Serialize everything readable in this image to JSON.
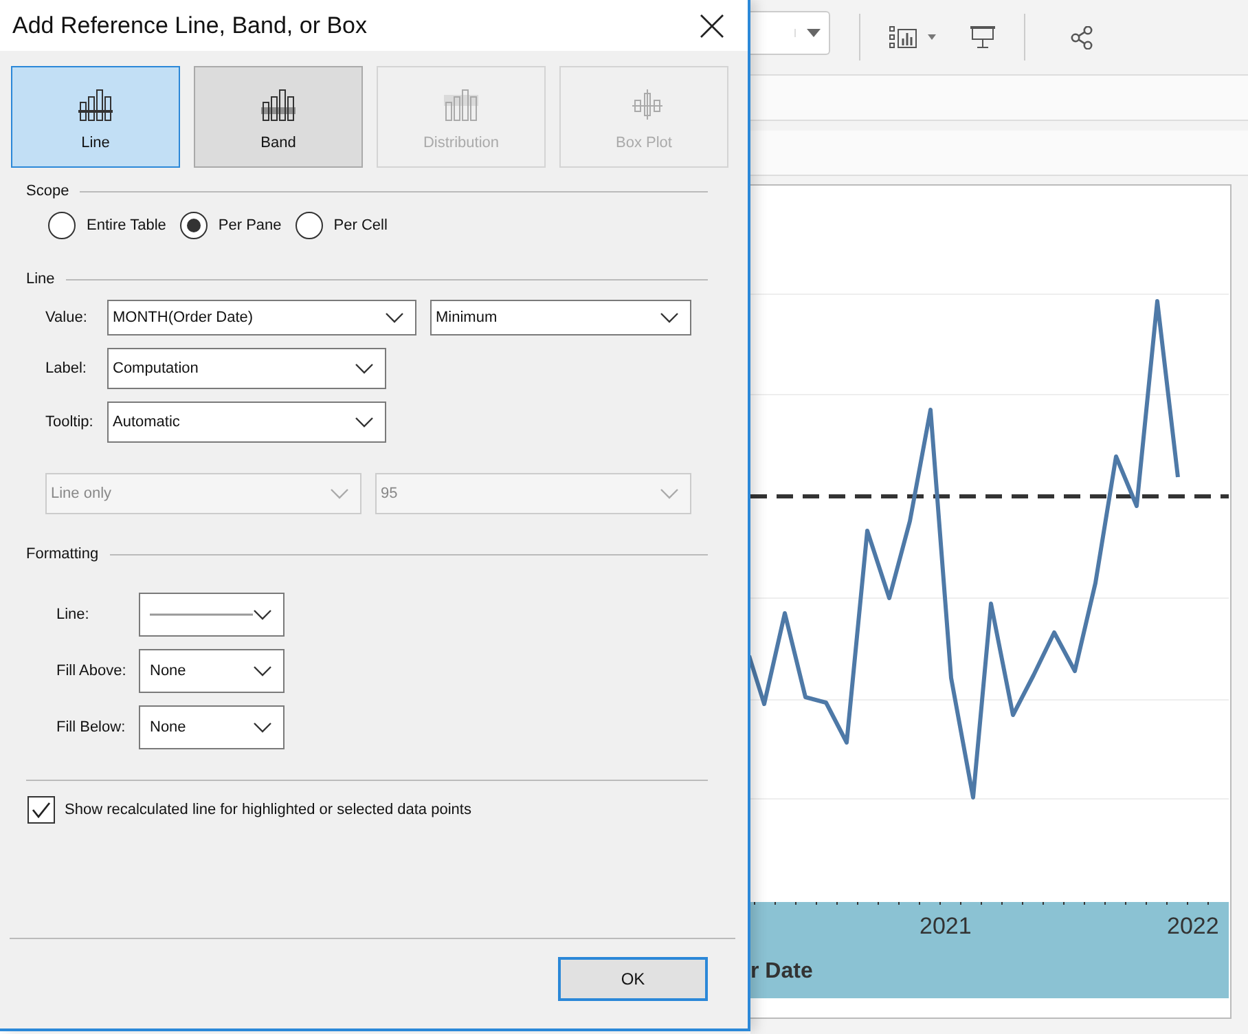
{
  "dialog": {
    "title": "Add Reference Line, Band, or Box",
    "types": [
      {
        "label": "Line",
        "selected": true,
        "disabled": false
      },
      {
        "label": "Band",
        "selected": false,
        "disabled": false
      },
      {
        "label": "Distribution",
        "selected": false,
        "disabled": true
      },
      {
        "label": "Box Plot",
        "selected": false,
        "disabled": true
      }
    ],
    "scope": {
      "heading": "Scope",
      "options": [
        {
          "label": "Entire Table",
          "selected": false
        },
        {
          "label": "Per Pane",
          "selected": true
        },
        {
          "label": "Per Cell",
          "selected": false
        }
      ]
    },
    "line": {
      "heading": "Line",
      "rows": [
        {
          "label": "Value:",
          "dropdowns": [
            {
              "value": "MONTH(Order Date)",
              "disabled": false
            },
            {
              "value": "Minimum",
              "disabled": false
            }
          ]
        },
        {
          "label": "Label:",
          "dropdowns": [
            {
              "value": "Computation",
              "disabled": false
            }
          ]
        },
        {
          "label": "Tooltip:",
          "dropdowns": [
            {
              "value": "Automatic",
              "disabled": false
            }
          ]
        },
        {
          "dropdowns": [
            {
              "value": "Line only",
              "disabled": true
            },
            {
              "value": "95",
              "disabled": true
            }
          ]
        }
      ]
    },
    "formatting": {
      "heading": "Formatting",
      "rows": [
        {
          "label": "Line:",
          "kind": "line-style"
        },
        {
          "label": "Fill Above:",
          "kind": "text",
          "value": "None"
        },
        {
          "label": "Fill Below:",
          "kind": "text",
          "value": "None"
        }
      ]
    },
    "recalculate": {
      "label": "Show recalculated line for highlighted or selected data points",
      "checked": true
    },
    "ok_button": "OK"
  },
  "chart": {
    "x_labels": [
      "2021",
      "2022"
    ],
    "axis_title": "r Date"
  }
}
